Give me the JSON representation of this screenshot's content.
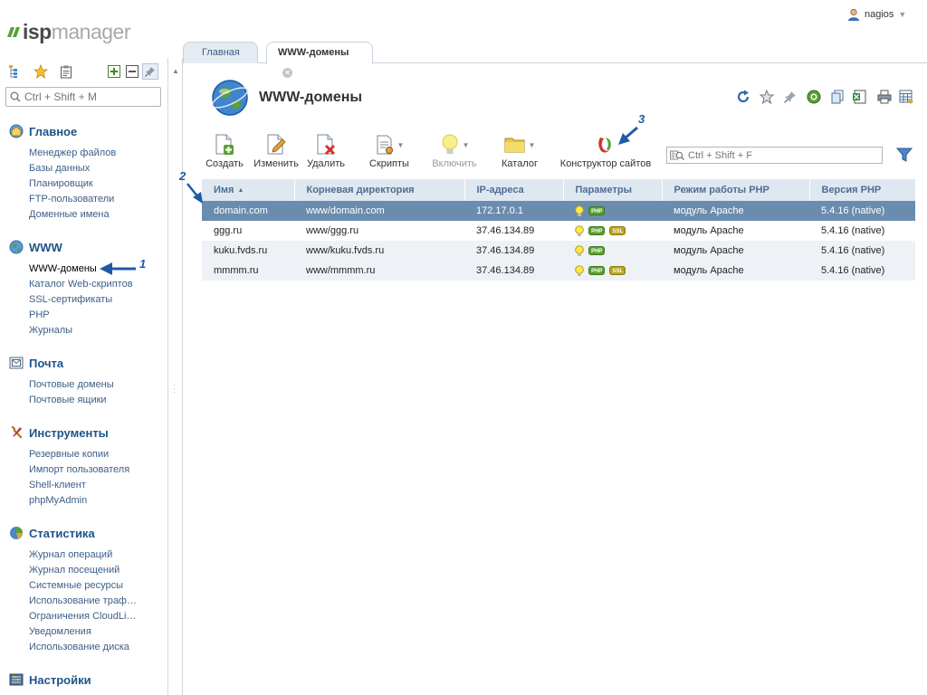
{
  "brand": {
    "logo_primary": "isp",
    "logo_secondary": "manager",
    "accent": "#5aa034"
  },
  "user": {
    "name": "nagios"
  },
  "sidebar": {
    "search_placeholder": "Ctrl + Shift + M",
    "tools": [
      "tree-icon",
      "star-icon",
      "clipboard-icon",
      "expand-all-icon",
      "collapse-all-icon",
      "pin-icon"
    ],
    "sections": [
      {
        "title": "Главное",
        "icon": "home-globe-icon",
        "items": [
          "Менеджер файлов",
          "Базы данных",
          "Планировщик",
          "FTP-пользователи",
          "Доменные имена"
        ]
      },
      {
        "title": "WWW",
        "icon": "globe-icon",
        "items": [
          "WWW-домены",
          "Каталог Web-скриптов",
          "SSL-сертификаты",
          "PHP",
          "Журналы"
        ]
      },
      {
        "title": "Почта",
        "icon": "mail-icon",
        "items": [
          "Почтовые домены",
          "Почтовые ящики"
        ]
      },
      {
        "title": "Инструменты",
        "icon": "tools-icon",
        "items": [
          "Резервные копии",
          "Импорт пользователя",
          "Shell-клиент",
          "phpMyAdmin"
        ]
      },
      {
        "title": "Статистика",
        "icon": "chart-pie-icon",
        "items": [
          "Журнал операций",
          "Журнал посещений",
          "Системные ресурсы",
          "Использование траф…",
          "Ограничения CloudLi…",
          "Уведомления",
          "Использование диска"
        ]
      },
      {
        "title": "Настройки",
        "icon": "settings-icon",
        "items": []
      }
    ],
    "active_item": "WWW-домены"
  },
  "tabs": [
    {
      "label": "Главная",
      "active": false
    },
    {
      "label": "WWW-домены",
      "active": true
    }
  ],
  "page": {
    "title": "WWW-домены"
  },
  "toolbar": {
    "buttons": [
      {
        "label": "Создать",
        "icon": "create-icon",
        "enabled": true
      },
      {
        "label": "Изменить",
        "icon": "edit-icon",
        "enabled": true
      },
      {
        "label": "Удалить",
        "icon": "delete-icon",
        "enabled": true
      },
      {
        "label": "Скрипты",
        "icon": "scripts-icon",
        "enabled": true
      },
      {
        "label": "Включить",
        "icon": "enable-bulb-icon",
        "enabled": false
      },
      {
        "label": "Каталог",
        "icon": "folder-icon",
        "enabled": true
      },
      {
        "label": "Конструктор сайтов",
        "icon": "site-builder-icon",
        "enabled": true
      }
    ],
    "search_placeholder": "Ctrl + Shift + F"
  },
  "table": {
    "columns": [
      "Имя",
      "Корневая директория",
      "IP-адреса",
      "Параметры",
      "Режим работы PHP",
      "Версия PHP"
    ],
    "rows": [
      {
        "name": "domain.com",
        "root": "www/domain.com",
        "ip": "172.17.0.1",
        "params": [
          "PHP"
        ],
        "php_mode": "модуль Apache",
        "php_version": "5.4.16 (native)",
        "selected": true
      },
      {
        "name": "ggg.ru",
        "root": "www/ggg.ru",
        "ip": "37.46.134.89",
        "params": [
          "PHP",
          "SSL"
        ],
        "php_mode": "модуль Apache",
        "php_version": "5.4.16 (native)",
        "selected": false
      },
      {
        "name": "kuku.fvds.ru",
        "root": "www/kuku.fvds.ru",
        "ip": "37.46.134.89",
        "params": [
          "PHP"
        ],
        "php_mode": "модуль Apache",
        "php_version": "5.4.16 (native)",
        "selected": false
      },
      {
        "name": "mmmm.ru",
        "root": "www/mmmm.ru",
        "ip": "37.46.134.89",
        "params": [
          "PHP",
          "SSL"
        ],
        "php_mode": "модуль Apache",
        "php_version": "5.4.16 (native)",
        "selected": false
      }
    ]
  },
  "annotations": [
    "1",
    "2",
    "3"
  ]
}
